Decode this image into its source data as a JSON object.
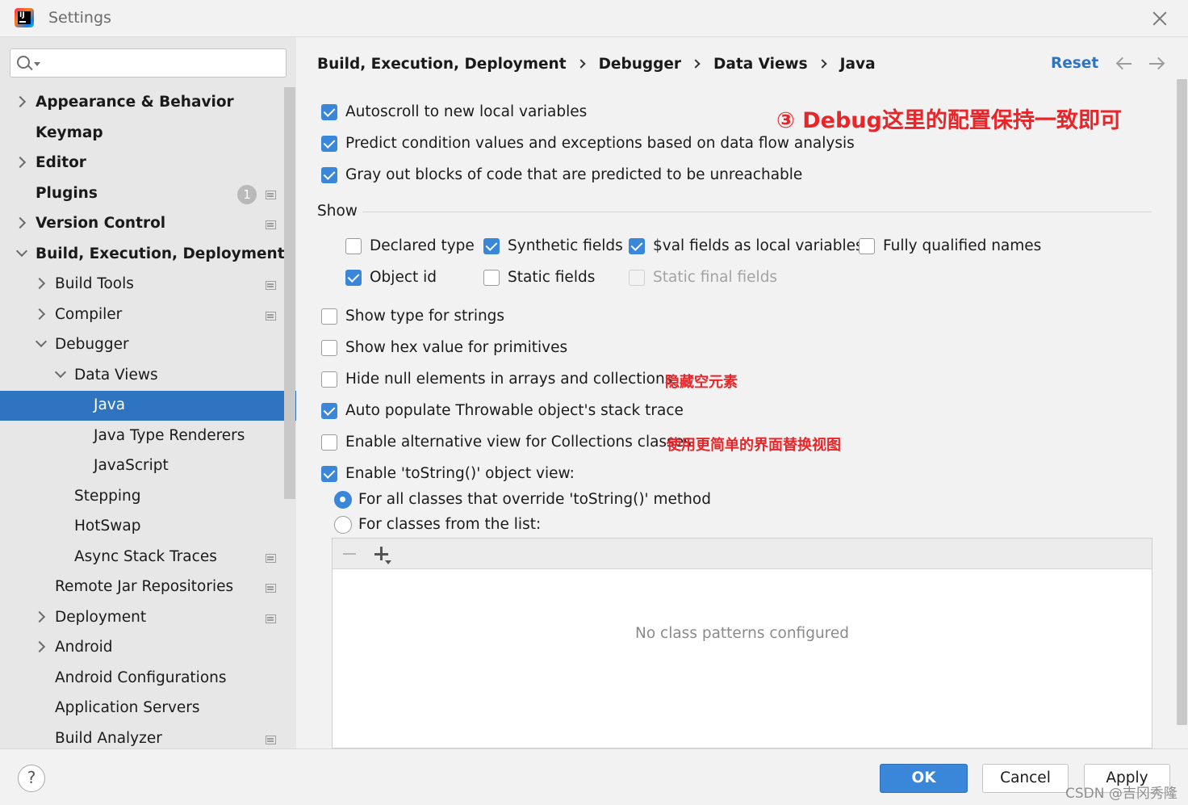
{
  "window": {
    "title": "Settings"
  },
  "search": {
    "value": "",
    "placeholder": ""
  },
  "sidebar": {
    "items": [
      {
        "label": "Appearance & Behavior"
      },
      {
        "label": "Keymap"
      },
      {
        "label": "Editor"
      },
      {
        "label": "Plugins",
        "badge": "1"
      },
      {
        "label": "Version Control"
      },
      {
        "label": "Build, Execution, Deployment"
      },
      {
        "label": "Build Tools"
      },
      {
        "label": "Compiler"
      },
      {
        "label": "Debugger"
      },
      {
        "label": "Data Views"
      },
      {
        "label": "Java",
        "selected": true
      },
      {
        "label": "Java Type Renderers"
      },
      {
        "label": "JavaScript"
      },
      {
        "label": "Stepping"
      },
      {
        "label": "HotSwap"
      },
      {
        "label": "Async Stack Traces"
      },
      {
        "label": "Remote Jar Repositories"
      },
      {
        "label": "Deployment"
      },
      {
        "label": "Android"
      },
      {
        "label": "Android Configurations"
      },
      {
        "label": "Application Servers"
      },
      {
        "label": "Build Analyzer"
      }
    ]
  },
  "breadcrumb": [
    "Build, Execution, Deployment",
    "Debugger",
    "Data Views",
    "Java"
  ],
  "header": {
    "reset_label": "Reset"
  },
  "options": {
    "autoscroll": {
      "label": "Autoscroll to new local variables",
      "checked": true
    },
    "predict": {
      "label": "Predict condition values and exceptions based on data flow analysis",
      "checked": true
    },
    "grayout": {
      "label": "Gray out blocks of code that are predicted to be unreachable",
      "checked": true
    },
    "show_group_label": "Show",
    "declared_type": {
      "label": "Declared type",
      "checked": false
    },
    "synthetic_fields": {
      "label": "Synthetic fields",
      "checked": true
    },
    "val_fields": {
      "label": "$val fields as local variables",
      "checked": true
    },
    "fully_qualified": {
      "label": "Fully qualified names",
      "checked": false
    },
    "object_id": {
      "label": "Object id",
      "checked": true
    },
    "static_fields": {
      "label": "Static fields",
      "checked": false
    },
    "static_final_fields": {
      "label": "Static final fields",
      "checked": false,
      "disabled": true
    },
    "show_type_strings": {
      "label": "Show type for strings",
      "checked": false
    },
    "show_hex": {
      "label": "Show hex value for primitives",
      "checked": false
    },
    "hide_null": {
      "label": "Hide null elements in arrays and collections",
      "checked": false
    },
    "auto_populate": {
      "label": "Auto populate Throwable object's stack trace",
      "checked": true
    },
    "alt_view": {
      "label": "Enable alternative view for Collections classes",
      "checked": false
    },
    "tostring_view": {
      "label": "Enable 'toString()' object view:",
      "checked": true
    },
    "radio_all": {
      "label": "For all classes that override 'toString()' method",
      "selected": true
    },
    "radio_list": {
      "label": "For classes from the list:",
      "selected": false
    }
  },
  "class_list": {
    "empty_text": "No class patterns configured"
  },
  "annotations": {
    "main": "③ Debug这里的配置保持一致即可",
    "hide_null": "隐藏空元素",
    "alt_view": "使用更简单的界面替换视图"
  },
  "footer": {
    "ok_label": "OK",
    "cancel_label": "Cancel",
    "apply_label": "Apply",
    "help_label": "?"
  },
  "watermark": "CSDN @吉冈秀隆",
  "colors": {
    "accent": "#3a86d8",
    "selection": "#2f74c0",
    "annotation": "#e8262a"
  }
}
